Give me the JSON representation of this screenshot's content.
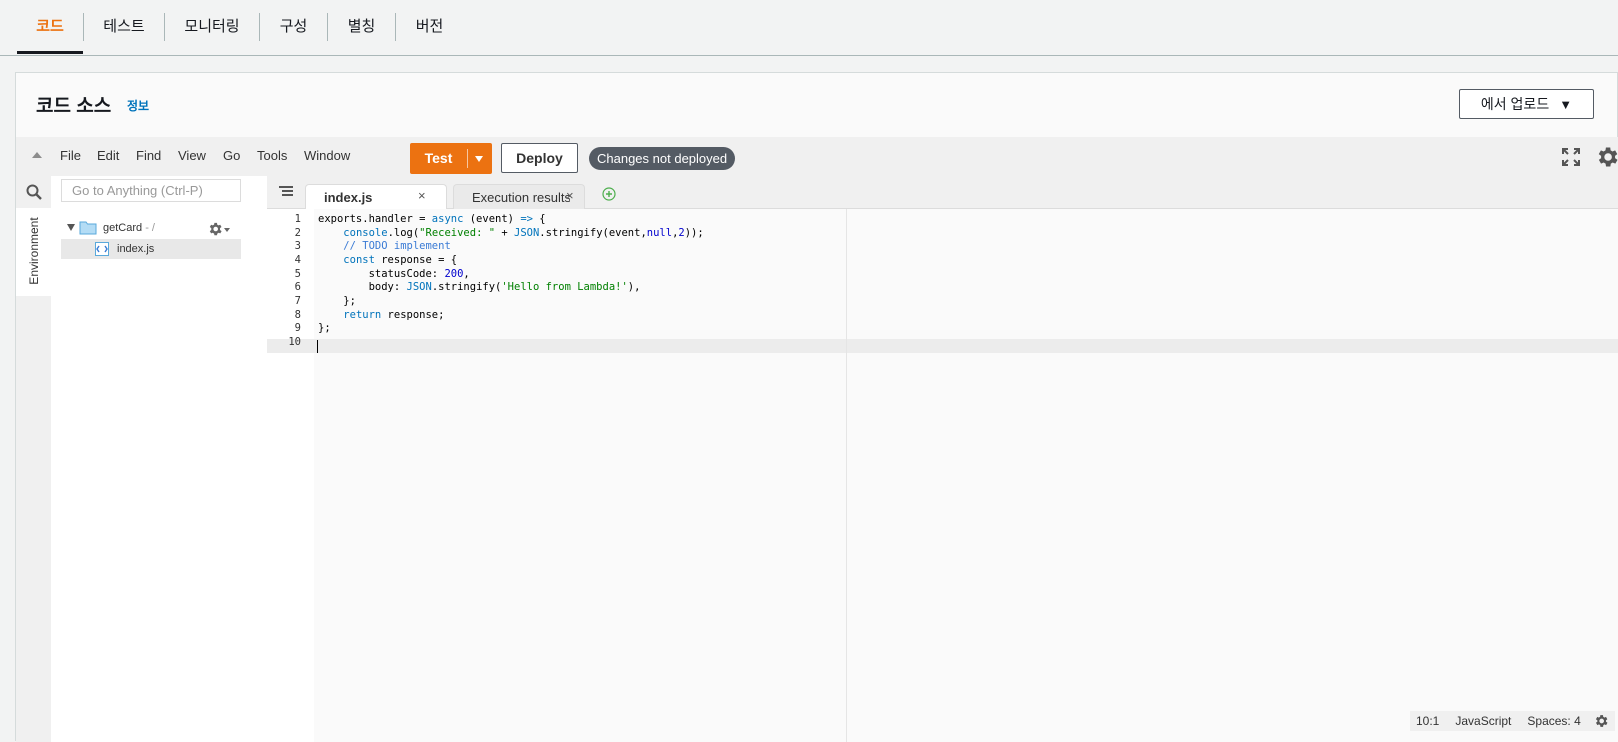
{
  "tabs": [
    {
      "label": "코드",
      "active": true
    },
    {
      "label": "테스트"
    },
    {
      "label": "모니터링"
    },
    {
      "label": "구성"
    },
    {
      "label": "별칭"
    },
    {
      "label": "버전"
    }
  ],
  "panel": {
    "title": "코드 소스",
    "info_link": "정보",
    "upload_label": "에서 업로드"
  },
  "menu": [
    "File",
    "Edit",
    "Find",
    "View",
    "Go",
    "Tools",
    "Window"
  ],
  "toolbar": {
    "test_label": "Test",
    "deploy_label": "Deploy",
    "status_badge": "Changes not deployed"
  },
  "sidebar": {
    "environment_tab": "Environment",
    "goto_placeholder": "Go to Anything (Ctrl-P)",
    "folder_name": "getCard",
    "folder_path": " - /",
    "file_name": "index.js"
  },
  "editor": {
    "tabs": [
      {
        "label": "index.js",
        "active": true
      },
      {
        "label": "Execution results",
        "active": false
      }
    ],
    "line_numbers": [
      "1",
      "2",
      "3",
      "4",
      "5",
      "6",
      "7",
      "8",
      "9",
      "10"
    ]
  },
  "statusbar": {
    "position": "10:1",
    "language": "JavaScript",
    "spaces": "Spaces: 4"
  },
  "colors": {
    "accent_orange": "#ec7211",
    "link_blue": "#0073bb",
    "badge_gray": "#545b64"
  }
}
